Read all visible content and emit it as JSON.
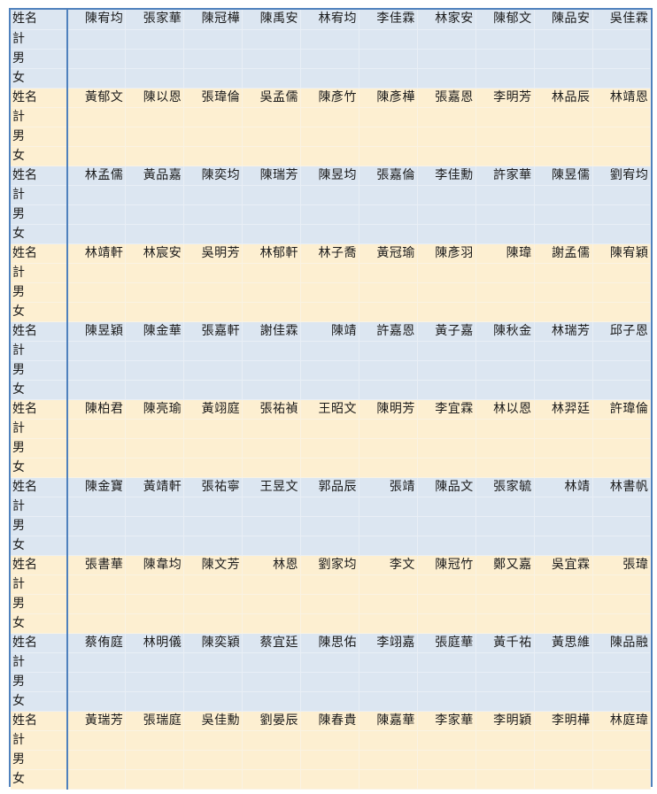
{
  "row_labels": {
    "name": "姓名",
    "total": "計",
    "male": "男",
    "female": "女"
  },
  "colors": {
    "band_blue": "#dce6f1",
    "band_yellow": "#fdefd1",
    "border_blue": "#4f81bd"
  },
  "groups": [
    {
      "names": [
        "陳宥均",
        "張家華",
        "陳冠樺",
        "陳禹安",
        "林宥均",
        "李佳霖",
        "林家安",
        "陳郁文",
        "陳品安",
        "吳佳霖"
      ]
    },
    {
      "names": [
        "黃郁文",
        "陳以恩",
        "張瑋倫",
        "吳孟儒",
        "陳彥竹",
        "陳彥樺",
        "張嘉恩",
        "李明芳",
        "林品辰",
        "林靖恩"
      ]
    },
    {
      "names": [
        "林孟儒",
        "黃品嘉",
        "陳奕均",
        "陳瑞芳",
        "陳昱均",
        "張嘉倫",
        "李佳勳",
        "許家華",
        "陳昱儒",
        "劉宥均"
      ]
    },
    {
      "names": [
        "林靖軒",
        "林宸安",
        "吳明芳",
        "林郁軒",
        "林子喬",
        "黃冠瑜",
        "陳彥羽",
        "陳瑋",
        "謝孟儒",
        "陳宥穎"
      ]
    },
    {
      "names": [
        "陳昱穎",
        "陳金華",
        "張嘉軒",
        "謝佳霖",
        "陳靖",
        "許嘉恩",
        "黃子嘉",
        "陳秋金",
        "林瑞芳",
        "邱子恩"
      ]
    },
    {
      "names": [
        "陳柏君",
        "陳亮瑜",
        "黃翊庭",
        "張祐禎",
        "王昭文",
        "陳明芳",
        "李宜霖",
        "林以恩",
        "林羿廷",
        "許瑋倫"
      ]
    },
    {
      "names": [
        "陳金寶",
        "黃靖軒",
        "張祐寧",
        "王昱文",
        "郭品辰",
        "張靖",
        "陳品文",
        "張家毓",
        "林靖",
        "林書帆"
      ]
    },
    {
      "names": [
        "張書華",
        "陳韋均",
        "陳文芳",
        "林恩",
        "劉家均",
        "李文",
        "陳冠竹",
        "鄭又嘉",
        "吳宜霖",
        "張瑋"
      ]
    },
    {
      "names": [
        "蔡侑庭",
        "林明儀",
        "陳奕穎",
        "蔡宜廷",
        "陳思佑",
        "李翊嘉",
        "張庭華",
        "黃千祐",
        "黃思維",
        "陳品融"
      ]
    },
    {
      "names": [
        "黃瑞芳",
        "張瑞庭",
        "吳佳勳",
        "劉晏辰",
        "陳春貴",
        "陳嘉華",
        "李家華",
        "李明穎",
        "李明樺",
        "林庭瑋"
      ]
    }
  ]
}
